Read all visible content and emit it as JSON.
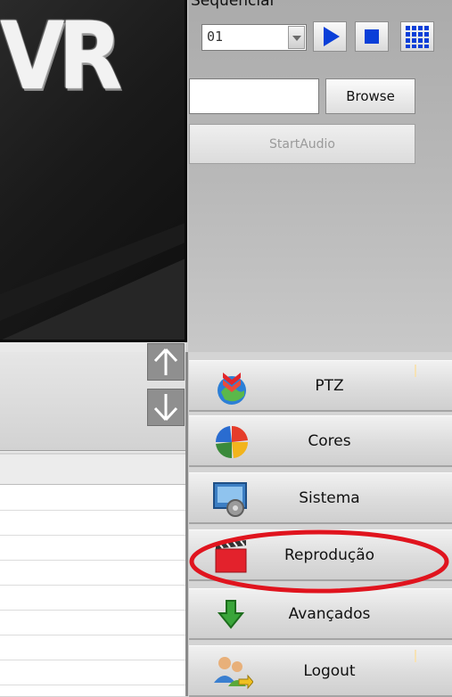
{
  "video_logo_text": "VR",
  "sequencial": {
    "label": "Sequencial",
    "selected": "01"
  },
  "controls": {
    "browse_label": "Browse",
    "start_audio_label": "StartAudio",
    "file_path": ""
  },
  "menu": [
    {
      "label": "PTZ",
      "icon": "ptz-icon"
    },
    {
      "label": "Cores",
      "icon": "colors-icon"
    },
    {
      "label": "Sistema",
      "icon": "system-icon"
    },
    {
      "label": "Reprodução",
      "icon": "playback-icon"
    },
    {
      "label": "Avançados",
      "icon": "advanced-icon"
    },
    {
      "label": "Logout",
      "icon": "logout-icon"
    }
  ],
  "highlighted_item": "Reprodução",
  "colors": {
    "play_blue": "#0a3fd8",
    "highlight_red": "#e0141e"
  }
}
